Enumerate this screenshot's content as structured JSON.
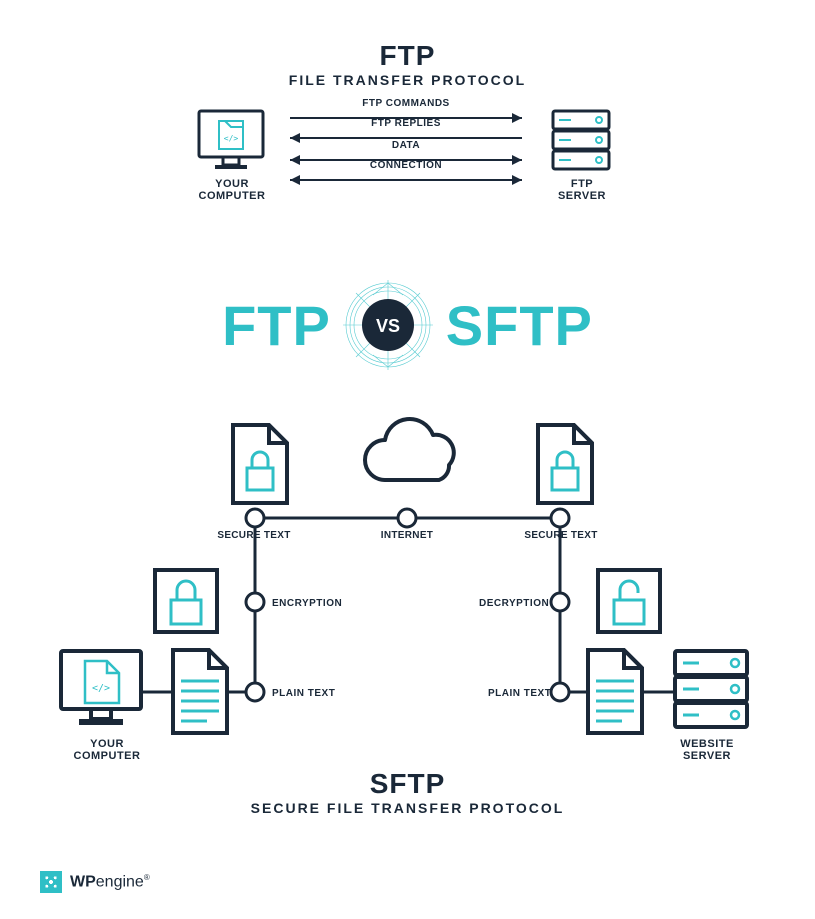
{
  "ftp": {
    "title": "FTP",
    "subtitle": "FILE TRANSFER PROTOCOL",
    "left_label_l1": "YOUR",
    "left_label_l2": "COMPUTER",
    "right_label_l1": "FTP",
    "right_label_l2": "SERVER",
    "arrows": {
      "commands": "FTP COMMANDS",
      "replies": "FTP REPLIES",
      "data": "DATA",
      "connection": "CONNECTION"
    }
  },
  "vs": {
    "left": "FTP",
    "badge": "VS",
    "right": "SFTP"
  },
  "sftp": {
    "title": "SFTP",
    "subtitle": "SECURE FILE TRANSFER PROTOCOL",
    "secure_text": "SECURE TEXT",
    "internet": "INTERNET",
    "encryption": "ENCRYPTION",
    "decryption": "DECRYPTION",
    "plain_text": "PLAIN TEXT",
    "your_computer_l1": "YOUR",
    "your_computer_l2": "COMPUTER",
    "website_server_l1": "WEBSITE",
    "website_server_l2": "SERVER"
  },
  "footer": {
    "brand_bold": "WP",
    "brand_light": "engine"
  },
  "colors": {
    "accent": "#2fbfc6",
    "dark": "#1a2838"
  }
}
